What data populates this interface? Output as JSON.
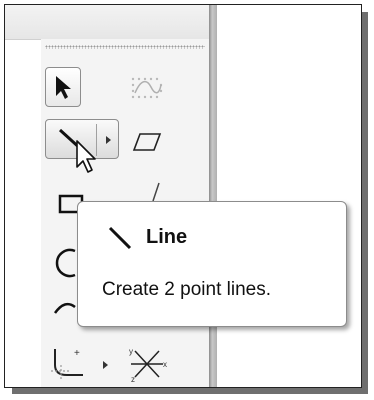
{
  "toolbar": {
    "tools": [
      {
        "icon": "select-arrow-icon"
      },
      {
        "icon": "spline-icon"
      },
      {
        "icon": "line-icon"
      },
      {
        "icon": "parallelogram-icon"
      },
      {
        "icon": "rectangle-icon"
      },
      {
        "icon": "circle-icon"
      },
      {
        "icon": "arc-icon"
      },
      {
        "icon": "fillet-icon"
      },
      {
        "icon": "axis-icon"
      }
    ]
  },
  "tooltip": {
    "title": "Line",
    "description": "Create 2 point lines."
  },
  "colors": {
    "panel_bg": "#f4f4f4",
    "tooltip_bg": "#ffffff",
    "text": "#111111"
  }
}
